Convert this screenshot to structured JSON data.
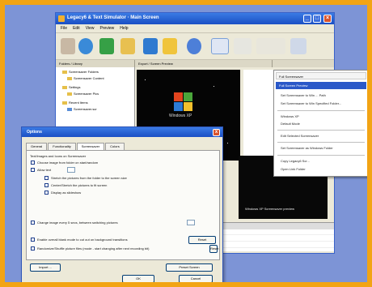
{
  "main_window": {
    "title": "Legacy6 & Text Simulator · Main Screen",
    "menu": [
      "File",
      "Edit",
      "View",
      "Preview",
      "Help"
    ],
    "panel_headers": [
      "Folders / Library",
      "Export / Screen Preview"
    ],
    "tree_items": [
      "Screensaver Folders",
      "Screensaver Content",
      "Settings",
      "Screensaver Pics",
      "Recent Items",
      "Screensaver.scr"
    ],
    "preview_caption": "Windows XP",
    "thumb_caption": "Windows XP Screensaver preview"
  },
  "context_menu": {
    "title": "Full Screensaver",
    "highlighted": "Full Screen Preview",
    "items": [
      "Set Screensaver to Win ... Path",
      "Set Screensaver to Win Specified Folder...",
      "Windows XP",
      "Default Mode",
      "Edit Selected Screensaver",
      "Set Screensaver as Windows Folder",
      "Copy Legacy6 Scr...",
      "Open Link Folder"
    ]
  },
  "options_dialog": {
    "title": "Options",
    "close_glyph": "x",
    "tabs": [
      "General",
      "Functionality",
      "Screensaver",
      "Colors"
    ],
    "active_tab": 2,
    "lines": [
      "Text/Images and Icons on Screensaver",
      "Choose image from folder on start/random",
      "Allow text",
      "Stretch the pictures from the folder to the screen size",
      "Center/Stretch the pictures to fit screen",
      "Display as slideshow",
      "Change image every 5 secs, between switching pictures",
      "Enable overall blank mode to cut out on background transitions",
      "Randomize/Shuffle picture files (mode - start changing after next recording bit)"
    ],
    "buttons": {
      "import": "Import ...",
      "reset": "Reset",
      "ok": "OK",
      "cancel": "Cancel",
      "preset_browse": "Preset Screen",
      "side": "Reset"
    }
  },
  "colors": {
    "frame": "#f2a414",
    "background": "#7d94d6",
    "title_bar": "#1a4fc4",
    "highlight": "#2a58c8",
    "close": "#d8532c"
  }
}
